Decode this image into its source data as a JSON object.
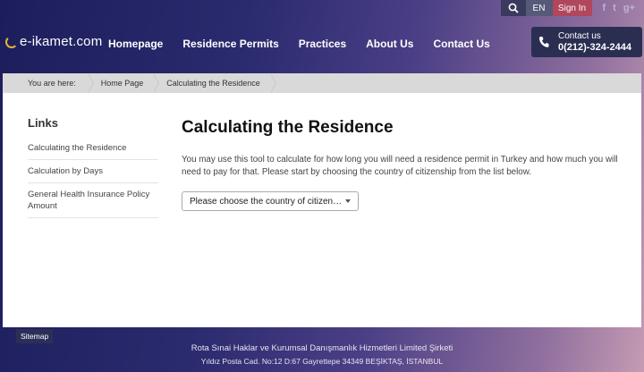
{
  "topbar": {
    "lang": "EN",
    "signin": "Sign In",
    "social": {
      "facebook": "f",
      "twitter": "t",
      "google": "g+"
    }
  },
  "logo": {
    "text": "e-ikamet.com"
  },
  "nav": [
    "Homepage",
    "Residence Permits",
    "Practices",
    "About Us",
    "Contact Us"
  ],
  "contact": {
    "label": "Contact us",
    "phone": "0(212)-324-2444"
  },
  "breadcrumb": {
    "prefix": "You are here:",
    "items": [
      "Home Page",
      "Calculating the Residence"
    ]
  },
  "sidebar": {
    "title": "Links",
    "items": [
      "Calculating the Residence",
      "Calculation by Days",
      "General Health Insurance Policy Amount"
    ]
  },
  "main": {
    "title": "Calculating the Residence",
    "description": "You may use this tool to calculate for how long you will need a residence permit in Turkey and how much you will need to pay for that. Please start by choosing the country of citizenship from the list below.",
    "select_value": "Please choose the country of citizen…"
  },
  "footer": {
    "sitemap": "Sitemap",
    "company": "Rota Sınai Haklar ve Kurumsal Danışmanlık Hizmetleri Limited Şirketi",
    "address": "Yıldız Posta Cad. No:12 D:67 Gayrettepe 34349 BEŞİKTAŞ, İSTANBUL"
  },
  "colors": {
    "signin_bg": "#b0475c",
    "card_bg": "#ffffff",
    "breadcrumb_bg": "#d9d9d9"
  }
}
